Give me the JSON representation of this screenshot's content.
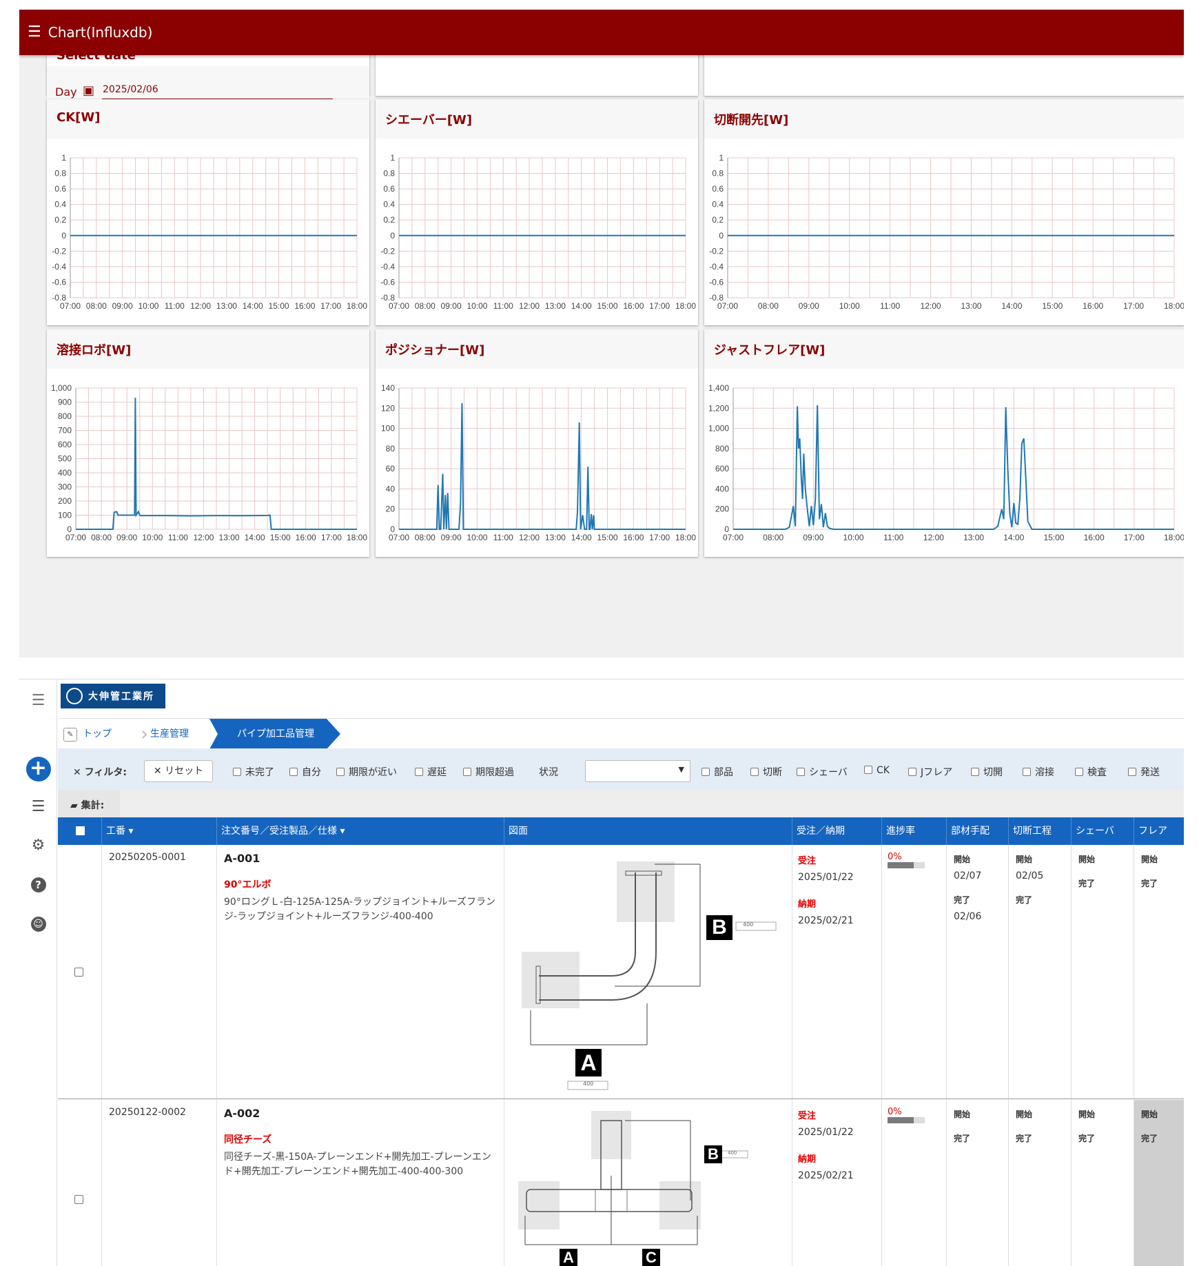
{
  "top_app": {
    "title": "Chart(Influxdb)",
    "select_date": {
      "heading": "Select date",
      "day_label": "Day",
      "date_value": "2025/02/06"
    }
  },
  "colors": {
    "brand": "#8b0000",
    "line": "#1f77b4",
    "grid": "#e8c7c7",
    "header_blue": "#1565c0"
  },
  "chart_data": [
    {
      "type": "line",
      "title": "CK[W]",
      "categories": [
        "07:00",
        "08:00",
        "09:00",
        "10:00",
        "11:00",
        "12:00",
        "13:00",
        "14:00",
        "15:00",
        "16:00",
        "17:00",
        "18:00"
      ],
      "ylim": [
        -0.8,
        1
      ],
      "yticks": [
        "1",
        "0.8",
        "0.6",
        "0.4",
        "0.2",
        "0",
        "-0.2",
        "-0.4",
        "-0.6",
        "-0.8"
      ],
      "ytick_values": [
        1,
        0.8,
        0.6,
        0.4,
        0.2,
        0,
        -0.2,
        -0.4,
        -0.6,
        -0.8
      ],
      "series": [
        {
          "x": [
            7.0,
            18.0
          ],
          "y": [
            0,
            0
          ]
        }
      ]
    },
    {
      "type": "line",
      "title": "シエーバー[W]",
      "categories": [
        "07:00",
        "08:00",
        "09:00",
        "10:00",
        "11:00",
        "12:00",
        "13:00",
        "14:00",
        "15:00",
        "16:00",
        "17:00",
        "18:00"
      ],
      "ylim": [
        -0.8,
        1
      ],
      "yticks": [
        "1",
        "0.8",
        "0.6",
        "0.4",
        "0.2",
        "0",
        "-0.2",
        "-0.4",
        "-0.6",
        "-0.8"
      ],
      "ytick_values": [
        1,
        0.8,
        0.6,
        0.4,
        0.2,
        0,
        -0.2,
        -0.4,
        -0.6,
        -0.8
      ],
      "series": [
        {
          "x": [
            7.0,
            18.0
          ],
          "y": [
            0,
            0
          ]
        }
      ]
    },
    {
      "type": "line",
      "title": "切断開先[W]",
      "categories": [
        "07:00",
        "08:00",
        "09:00",
        "10:00",
        "11:00",
        "12:00",
        "13:00",
        "14:00",
        "15:00",
        "16:00",
        "17:00",
        "18:00"
      ],
      "ylim": [
        -0.8,
        1
      ],
      "yticks": [
        "1",
        "0.8",
        "0.6",
        "0.4",
        "0.2",
        "0",
        "-0.2",
        "-0.4",
        "-0.6",
        "-0.8"
      ],
      "ytick_values": [
        1,
        0.8,
        0.6,
        0.4,
        0.2,
        0,
        -0.2,
        -0.4,
        -0.6,
        -0.8
      ],
      "series": [
        {
          "x": [
            7.0,
            18.0
          ],
          "y": [
            0,
            0
          ]
        }
      ]
    },
    {
      "type": "line",
      "title": "溶接ロボ[W]",
      "categories": [
        "07:00",
        "08:00",
        "09:00",
        "10:00",
        "11:00",
        "12:00",
        "13:00",
        "14:00",
        "15:00",
        "16:00",
        "17:00",
        "18:00"
      ],
      "ylim": [
        0,
        1000
      ],
      "yticks": [
        "1,000",
        "900",
        "800",
        "700",
        "600",
        "500",
        "400",
        "300",
        "200",
        "100",
        "0"
      ],
      "ytick_values": [
        1000,
        900,
        800,
        700,
        600,
        500,
        400,
        300,
        200,
        100,
        0
      ],
      "series": [
        {
          "x": [
            7.0,
            8.45,
            8.5,
            8.6,
            8.65,
            9.2,
            9.3,
            9.33,
            9.36,
            9.45,
            9.5,
            9.55,
            10.5,
            11.5,
            12.5,
            13.5,
            14.5,
            14.6,
            14.65,
            15.5,
            16.5,
            18.0
          ],
          "y": [
            0,
            0,
            120,
            125,
            100,
            100,
            100,
            930,
            100,
            125,
            100,
            97,
            97,
            95,
            97,
            96,
            98,
            100,
            0,
            0,
            0,
            0
          ]
        }
      ]
    },
    {
      "type": "line",
      "title": "ポジショナー[W]",
      "categories": [
        "07:00",
        "08:00",
        "09:00",
        "10:00",
        "11:00",
        "12:00",
        "13:00",
        "14:00",
        "15:00",
        "16:00",
        "17:00",
        "18:00"
      ],
      "ylim": [
        0,
        140
      ],
      "yticks": [
        "140",
        "120",
        "100",
        "80",
        "60",
        "40",
        "20",
        "0"
      ],
      "ytick_values": [
        140,
        120,
        100,
        80,
        60,
        40,
        20,
        0
      ],
      "series": [
        {
          "x": [
            7.0,
            8.45,
            8.5,
            8.55,
            8.6,
            8.68,
            8.72,
            8.78,
            8.82,
            8.87,
            8.92,
            8.97,
            9.3,
            9.36,
            9.42,
            9.47,
            9.52,
            13.8,
            13.85,
            13.92,
            13.97,
            14.05,
            14.12,
            14.2,
            14.25,
            14.3,
            14.33,
            14.38,
            14.42,
            14.47,
            14.5,
            14.55,
            18.0
          ],
          "y": [
            0,
            0,
            44,
            0,
            0,
            55,
            0,
            34,
            0,
            36,
            0,
            0,
            0,
            25,
            125,
            0,
            0,
            0,
            18,
            106,
            0,
            14,
            0,
            0,
            62,
            0,
            0,
            15,
            0,
            14,
            0,
            0,
            0
          ]
        }
      ]
    },
    {
      "type": "line",
      "title": "ジャストフレア[W]",
      "categories": [
        "07:00",
        "08:00",
        "09:00",
        "10:00",
        "11:00",
        "12:00",
        "13:00",
        "14:00",
        "15:00",
        "16:00",
        "17:00",
        "18:00"
      ],
      "ylim": [
        0,
        1400
      ],
      "yticks": [
        "1,400",
        "1,200",
        "1,000",
        "800",
        "600",
        "400",
        "200",
        "0"
      ],
      "ytick_values": [
        1400,
        1200,
        1000,
        800,
        600,
        400,
        200,
        0
      ],
      "series": [
        {
          "x": [
            7.0,
            8.3,
            8.4,
            8.5,
            8.55,
            8.6,
            8.63,
            8.66,
            8.7,
            8.73,
            8.76,
            8.8,
            8.85,
            8.9,
            8.95,
            9.0,
            9.05,
            9.1,
            9.15,
            9.2,
            9.25,
            9.3,
            9.35,
            9.4,
            9.5,
            13.5,
            13.6,
            13.7,
            13.75,
            13.8,
            13.85,
            13.9,
            13.95,
            14.0,
            14.05,
            14.1,
            14.15,
            14.2,
            14.25,
            14.3,
            14.35,
            14.45,
            18.0
          ],
          "y": [
            0,
            0,
            20,
            230,
            30,
            1220,
            800,
            900,
            500,
            300,
            750,
            400,
            200,
            30,
            230,
            40,
            300,
            1230,
            100,
            250,
            20,
            160,
            30,
            10,
            0,
            0,
            30,
            200,
            100,
            1210,
            600,
            150,
            20,
            260,
            60,
            50,
            300,
            850,
            900,
            500,
            80,
            0,
            0
          ]
        }
      ]
    }
  ],
  "pipe_app": {
    "logo_text": "大伸管工業所",
    "breadcrumb": [
      "トップ",
      "生産管理",
      "パイプ加工品管理"
    ],
    "filter": {
      "label": "フィルタ:",
      "reset": "リセット",
      "checks1": [
        "未完了",
        "自分",
        "期限が近い",
        "遅延",
        "期限超過"
      ],
      "status_label": "状況",
      "checks2": [
        "部品",
        "切断",
        "シェーバ",
        "CK",
        "Jフレア",
        "切開",
        "溶接",
        "検査",
        "発送"
      ]
    },
    "summary_label": "集計:",
    "columns": [
      "工番",
      "注文番号／受注製品／仕様",
      "図面",
      "受注／納期",
      "進捗率",
      "部材手配",
      "切断工程",
      "シェーバ",
      "フレア"
    ],
    "rows": [
      {
        "id": "20250205-0001",
        "code": "A-001",
        "product": "90°エルボ",
        "spec": "90°ロングＬ-白-125A-125A-ラップジョイント+ルーズフランジ-ラップジョイント+ルーズフランジ-400-400",
        "order_label": "受注",
        "order_date": "2025/01/22",
        "due_label": "納期",
        "due_date": "2025/02/21",
        "progress": "0%",
        "materials": {
          "start": "開始",
          "start_date": "02/07",
          "done": "完了",
          "done_date": "02/06"
        },
        "cutting": {
          "start": "開始",
          "start_date": "02/05",
          "done": "完了"
        },
        "shaver": {
          "start": "開始",
          "done": "完了"
        },
        "flare": {
          "start": "開始",
          "done": "完了"
        },
        "drawing_labels": {
          "b": "B",
          "b_value": "400",
          "a": "A",
          "a_value": "400"
        }
      },
      {
        "id": "20250122-0002",
        "code": "A-002",
        "product": "同径チーズ",
        "spec": "同径チーズ-黒-150A-プレーンエンド+開先加工-プレーンエンド+開先加工-プレーンエンド+開先加工-400-400-300",
        "order_label": "受注",
        "order_date": "2025/01/22",
        "due_label": "納期",
        "due_date": "2025/02/21",
        "progress": "0%",
        "materials": {
          "start": "開始",
          "done": "完了"
        },
        "cutting": {
          "start": "開始",
          "done": "完了"
        },
        "shaver": {
          "start": "開始",
          "done": "完了"
        },
        "flare": {
          "start": "開始",
          "done": "完了"
        },
        "drawing_labels": {
          "b": "B",
          "b_value": "400",
          "a": "A",
          "c": "C"
        }
      }
    ]
  }
}
